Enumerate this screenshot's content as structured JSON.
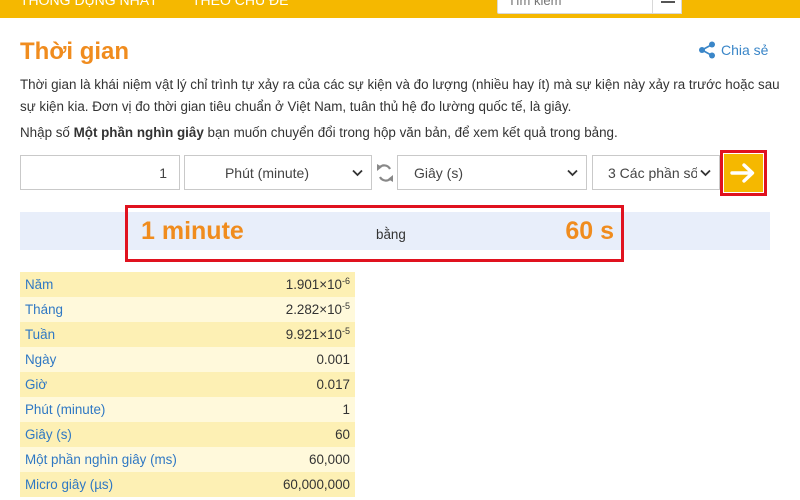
{
  "header": {
    "nav_items": [
      "THÔNG DỤNG NHẤT",
      "THEO CHỦ ĐỀ"
    ],
    "search_placeholder": "Tìm kiếm"
  },
  "page": {
    "title": "Thời gian",
    "share_label": "Chia sẻ",
    "description": "Thời gian là khái niệm vật lý chỉ trình tự xảy ra của các sự kiện và đo lượng (nhiều hay ít) mà sự kiện này xảy ra trước hoặc sau sự kiện kia. Đơn vị đo thời gian tiêu chuẩn ở Việt Nam, tuân thủ hệ đo lường quốc tế, là giây.",
    "instruction_pre": "Nhập số ",
    "instruction_bold": "Một phần nghìn giây",
    "instruction_post": " bạn muốn chuyển đổi trong hộp văn bản, để xem kết quả trong bảng."
  },
  "converter": {
    "input_value": "1",
    "from_unit": "Phút (minute)",
    "to_unit": "Giây (s)",
    "precision": "3 Các phần số"
  },
  "result": {
    "left": "1 minute",
    "middle": "bằng",
    "right": "60 s"
  },
  "table": {
    "rows": [
      {
        "unit": "Năm",
        "mantissa": "1.901×10",
        "exp": "-6"
      },
      {
        "unit": "Tháng",
        "mantissa": "2.282×10",
        "exp": "-5"
      },
      {
        "unit": "Tuần",
        "mantissa": "9.921×10",
        "exp": "-5"
      },
      {
        "unit": "Ngày",
        "mantissa": "0.001",
        "exp": ""
      },
      {
        "unit": "Giờ",
        "mantissa": "0.017",
        "exp": ""
      },
      {
        "unit": "Phút (minute)",
        "mantissa": "1",
        "exp": ""
      },
      {
        "unit": "Giây (s)",
        "mantissa": "60",
        "exp": ""
      },
      {
        "unit": "Một phần nghìn giây (ms)",
        "mantissa": "60,000",
        "exp": ""
      },
      {
        "unit": "Micro giây (µs)",
        "mantissa": "60,000,000",
        "exp": ""
      }
    ]
  },
  "icons": {
    "search": "search-icon",
    "share": "share-icon",
    "swap": "swap-icon",
    "go": "arrow-right-icon",
    "caret": "chevron-down-icon"
  },
  "colors": {
    "brand_yellow": "#f5b800",
    "title_orange": "#f08c1e",
    "link_blue": "#2f78c4",
    "highlight_red": "#e0121f",
    "result_band": "#e8eefa",
    "row_odd": "#fdf0b4",
    "row_even": "#fff9db"
  }
}
